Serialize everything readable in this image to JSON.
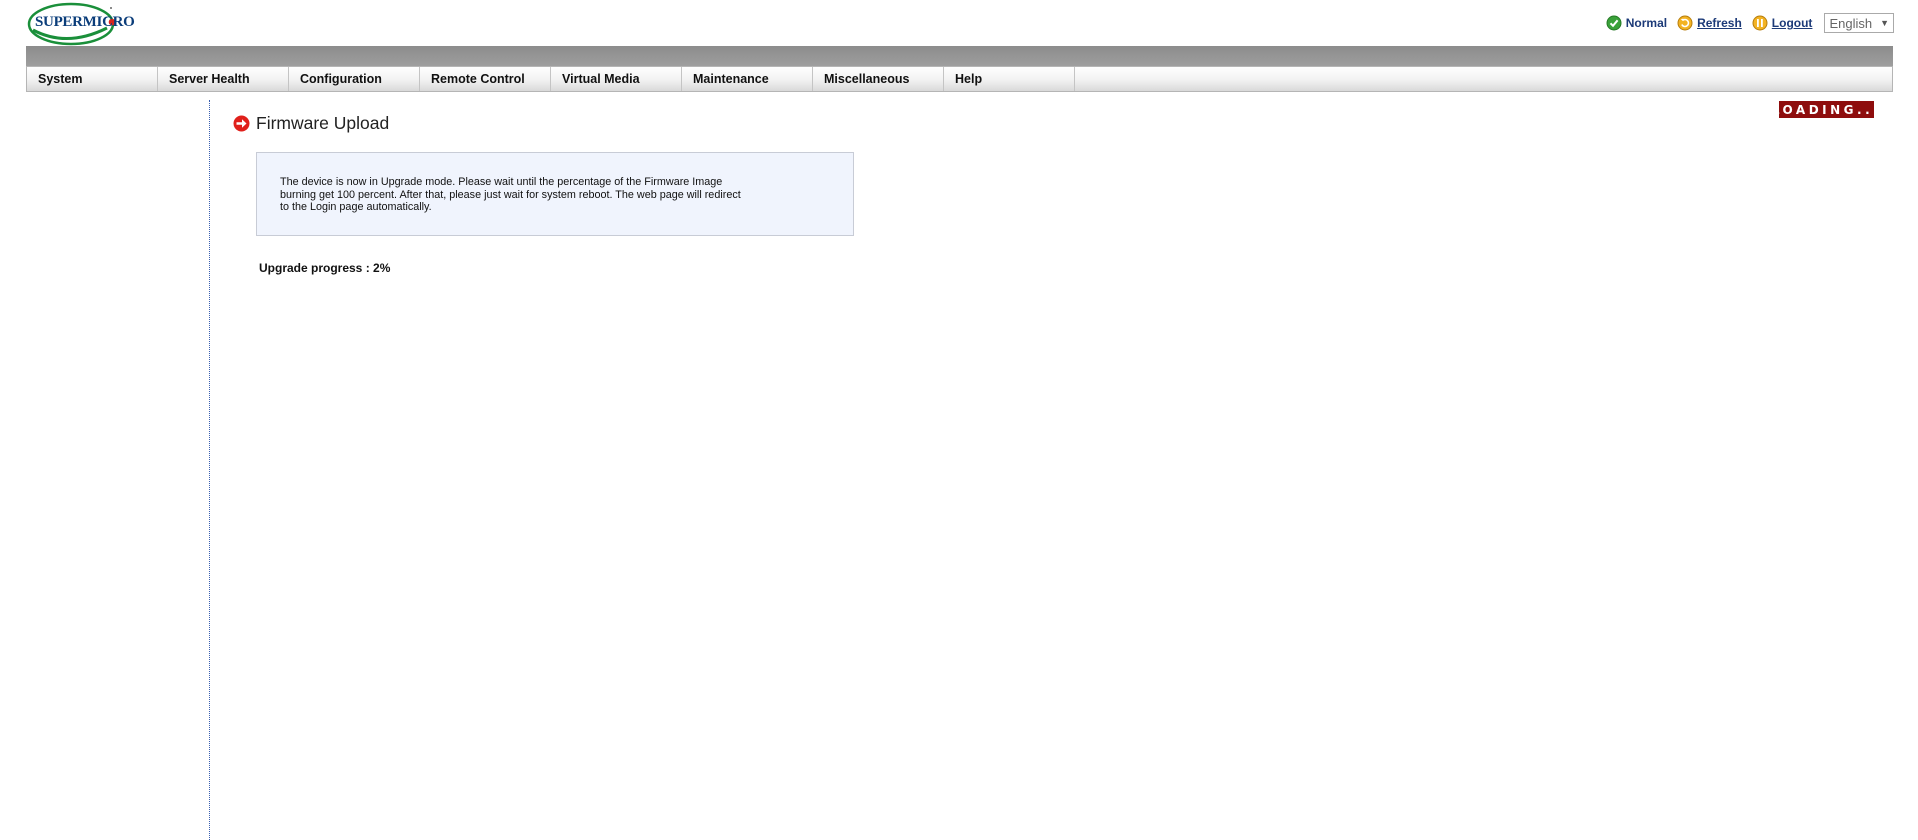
{
  "header": {
    "logo": {
      "text": "SUPERMICRO"
    },
    "status": {
      "label": "Normal",
      "icon": "check-circle-icon",
      "color": "#3aa13a"
    },
    "refresh_label": "Refresh",
    "logout_label": "Logout",
    "language": {
      "selected": "English"
    }
  },
  "menu": {
    "items": [
      {
        "label": "System"
      },
      {
        "label": "Server Health"
      },
      {
        "label": "Configuration"
      },
      {
        "label": "Remote Control"
      },
      {
        "label": "Virtual Media"
      },
      {
        "label": "Maintenance"
      },
      {
        "label": "Miscellaneous"
      },
      {
        "label": "Help"
      }
    ]
  },
  "loading_badge": "LOADING...",
  "main": {
    "title": "Firmware Upload",
    "title_icon": "arrow-right-circle-icon",
    "info_message": "The device is now in Upgrade mode. Please wait until the percentage of the Firmware Image burning get 100 percent. After that, please just wait for system reboot. The web page will redirect to the Login page automatically.",
    "progress_text": "Upgrade progress : 2%",
    "progress_percent": 2
  },
  "colors": {
    "accent": "#1c3a78",
    "loading_bg": "#8e0d0d",
    "info_bg": "#f0f4fd",
    "title_icon": "#e0201b"
  }
}
